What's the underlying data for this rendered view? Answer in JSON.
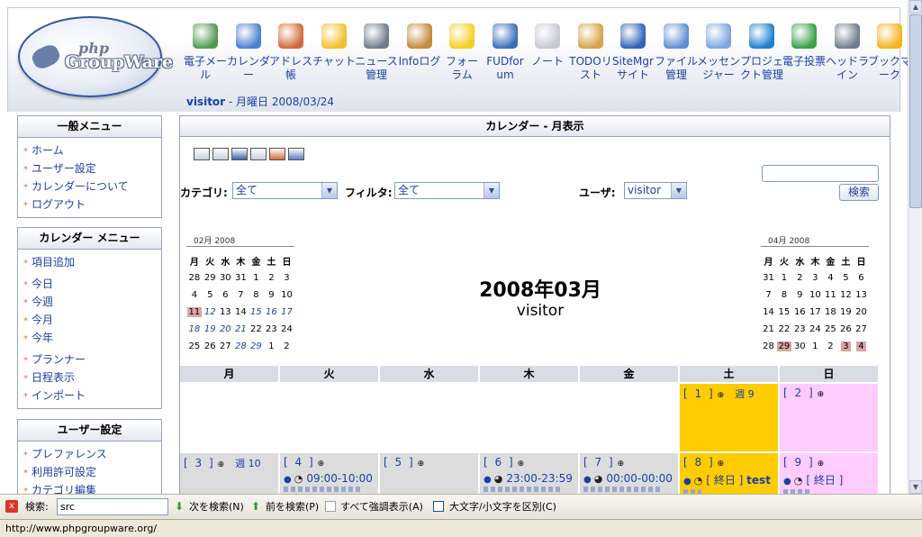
{
  "header": {
    "logo_text_php": "php",
    "logo_text_gw": "GroupWare",
    "user_name": "visitor",
    "user_date": " - 月曜日 2008/03/24"
  },
  "apps": [
    {
      "label": "電子メール",
      "icon": "email-icon",
      "color": "#4f9a4f"
    },
    {
      "label": "カレンダー",
      "icon": "calendar-icon",
      "color": "#4b7fd1"
    },
    {
      "label": "アドレス帳",
      "icon": "addressbook-icon",
      "color": "#d26a3a"
    },
    {
      "label": "チャット",
      "icon": "chat-icon",
      "color": "#f1c02a"
    },
    {
      "label": "ニュース管理",
      "icon": "news-icon",
      "color": "#6f7a8c"
    },
    {
      "label": "Infoログ",
      "icon": "infolog-icon",
      "color": "#c48a3c"
    },
    {
      "label": "フォーラム",
      "icon": "smiley-icon",
      "color": "#f5d020"
    },
    {
      "label": "FUDforum",
      "icon": "penguin-icon",
      "color": "#3a6fb8"
    },
    {
      "label": "ノート",
      "icon": "notes-icon",
      "color": "#c6c9d2"
    },
    {
      "label": "TODOリスト",
      "icon": "todo-icon",
      "color": "#d7a24a"
    },
    {
      "label": "SiteMgrサイト",
      "icon": "globe-icon",
      "color": "#2f63b5"
    },
    {
      "label": "ファイル管理",
      "icon": "folder-icon",
      "color": "#5f8fd3"
    },
    {
      "label": "メッセンジャー",
      "icon": "messenger-icon",
      "color": "#7da7e0"
    },
    {
      "label": "プロジェクト管理",
      "icon": "gear-icon",
      "color": "#1f7fd0"
    },
    {
      "label": "電子投票",
      "icon": "poll-icon",
      "color": "#3aa04a"
    },
    {
      "label": "ヘッドライン",
      "icon": "headlines-icon",
      "color": "#6f7a8c"
    },
    {
      "label": "ブックマーク",
      "icon": "star-icon",
      "color": "#f2b41c"
    }
  ],
  "sidebar": {
    "general": {
      "title": "一般メニュー",
      "items": [
        "ホーム",
        "ユーザー設定",
        "カレンダーについて",
        "ログアウト"
      ]
    },
    "calendar": {
      "title": "カレンダー メニュー",
      "items": [
        "項目追加",
        "今日",
        "今週",
        "今月",
        "今年",
        "プランナー",
        "日程表示",
        "インポート"
      ]
    },
    "user": {
      "title": "ユーザー設定",
      "items": [
        "プレファレンス",
        "利用許可設定",
        "カテゴリ編集"
      ]
    }
  },
  "main": {
    "title": "カレンダー - 月表示",
    "category_label": "カテゴリ:",
    "category_value": "全て",
    "filter_label": "フィルタ:",
    "filter_value": "全て",
    "user_label": "ユーザ:",
    "user_value": "visitor",
    "search_button": "検索",
    "month_title": "2008年03月",
    "month_user": "visitor"
  },
  "mini_prev": {
    "title": "02月 2008",
    "weekdays": [
      "月",
      "火",
      "水",
      "木",
      "金",
      "土",
      "日"
    ],
    "rows": [
      [
        "28",
        "29",
        "30",
        "31",
        "1",
        "2",
        "3"
      ],
      [
        "4",
        "5",
        "6",
        "7",
        "8",
        "9",
        "10"
      ],
      [
        "11",
        "12",
        "13",
        "14",
        "15",
        "16",
        "17"
      ],
      [
        "18",
        "19",
        "20",
        "21",
        "22",
        "23",
        "24"
      ],
      [
        "25",
        "26",
        "27",
        "28",
        "29",
        "1",
        "2"
      ]
    ]
  },
  "mini_next": {
    "title": "04月 2008",
    "weekdays": [
      "月",
      "火",
      "水",
      "木",
      "金",
      "土",
      "日"
    ],
    "rows": [
      [
        "31",
        "1",
        "2",
        "3",
        "4",
        "5",
        "6"
      ],
      [
        "7",
        "8",
        "9",
        "10",
        "11",
        "12",
        "13"
      ],
      [
        "14",
        "15",
        "16",
        "17",
        "18",
        "19",
        "20"
      ],
      [
        "21",
        "22",
        "23",
        "24",
        "25",
        "26",
        "27"
      ],
      [
        "28",
        "29",
        "30",
        "1",
        "2",
        "3",
        "4"
      ]
    ]
  },
  "month_grid": {
    "weekdays": [
      "月",
      "火",
      "水",
      "木",
      "金",
      "土",
      "日"
    ],
    "week1": {
      "sat": "[ 1 ]",
      "sat_week": "週 9",
      "sun": "[ 2 ]"
    },
    "week2": {
      "mon": "[ 3 ]",
      "mon_week": "週 10",
      "tue": "[ 4 ]",
      "tue_event": "09:00-10:00",
      "wed": "[ 5 ]",
      "thu": "[ 6 ]",
      "thu_event": "23:00-23:59",
      "fri": "[ 7 ]",
      "fri_event": "00:00-00:00",
      "sat": "[ 8 ]",
      "sat_event": "[ 終日 ]",
      "sat_event_title": "test",
      "sun": "[ 9 ]",
      "sun_event": "[ 終日 ]"
    }
  },
  "findbar": {
    "close_label": "x",
    "label": "検索:",
    "query": "src",
    "next": "次を検索(N)",
    "prev": "前を検索(P)",
    "highlight": "すべて強調表示(A)",
    "match_case": "大文字/小文字を区別(C)"
  },
  "status": {
    "url": "http://www.phpgroupware.org/"
  }
}
